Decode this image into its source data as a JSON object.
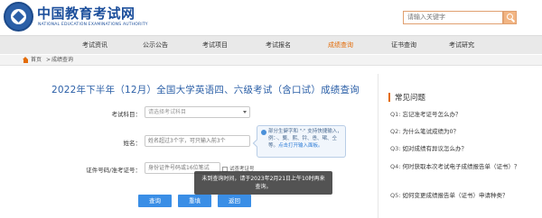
{
  "header": {
    "logo_cn": "中国教育考试网",
    "logo_en": "NATIONAL EDUCATION EXAMINATIONS AUTHORITY",
    "search_placeholder": "请输入关键字"
  },
  "nav": {
    "items": [
      {
        "label": "考试资讯",
        "active": false
      },
      {
        "label": "公示公告",
        "active": false
      },
      {
        "label": "考试项目",
        "active": false
      },
      {
        "label": "考试报名",
        "active": false
      },
      {
        "label": "成绩查询",
        "active": true
      },
      {
        "label": "证书查询",
        "active": false
      },
      {
        "label": "考试研究",
        "active": false
      }
    ]
  },
  "breadcrumb": {
    "home": "首页",
    "separator": ">",
    "current": "成绩查询"
  },
  "main": {
    "title": "2022年下半年（12月）全国大学英语四、六级考试（含口试）成绩查询",
    "subject_label": "考试科目：",
    "subject_placeholder": "请选择考试科目",
    "name_label": "姓名：",
    "name_placeholder": "姓名超过3个字，可只输入前3个",
    "id_label": "证件号码/准考证号：",
    "id_placeholder": "身份证件号码或16位笔试",
    "checkbox_label": "试查考证号",
    "tip_text": "部分生僻字和 \"·\" 支持快捷输入，例：·、龑、熙、钤、恿、珺、仝等。",
    "tip_link": "点击打开输入面板。",
    "buttons": {
      "query": "查询",
      "reset": "重填",
      "cancel": "返回"
    },
    "toast": "未到查询时间，请于2023年2月21日上午10时再来查询。"
  },
  "faq": {
    "title": "常见问题",
    "items": [
      {
        "q": "Q1:",
        "text": "忘记准考证号怎么办？"
      },
      {
        "q": "Q2:",
        "text": "为什么笔试成绩为0？"
      },
      {
        "q": "Q3:",
        "text": "如对成绩有异议怎么办？"
      },
      {
        "q": "Q4:",
        "text": "何时获取本次考试电子成绩报告单（证书）？"
      },
      {
        "q": "Q5:",
        "text": "如何变更成绩报告单（证书）申请种类？"
      }
    ]
  },
  "colors": {
    "brand_blue": "#1b4e9b",
    "accent_orange": "#e36c09",
    "button_blue": "#3a8ee6"
  }
}
